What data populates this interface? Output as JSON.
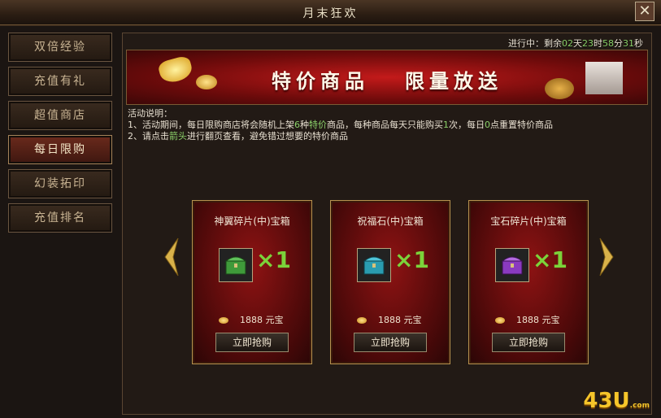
{
  "window": {
    "title": "月末狂欢",
    "close_label": "✕"
  },
  "sidebar": {
    "items": [
      {
        "label": "双倍经验"
      },
      {
        "label": "充值有礼"
      },
      {
        "label": "超值商店"
      },
      {
        "label": "每日限购"
      },
      {
        "label": "幻装拓印"
      },
      {
        "label": "充值排名"
      }
    ]
  },
  "status": {
    "prefix": "进行中：剩余",
    "days": "02",
    "days_unit": "天",
    "hours": "23",
    "hours_unit": "时",
    "minutes": "58",
    "minutes_unit": "分",
    "seconds": "31",
    "seconds_unit": "秒"
  },
  "banner": {
    "text1": "特价商品",
    "text2": "限量放送"
  },
  "description": {
    "title": "活动说明：",
    "line1_a": "1、活动期间，每日限购商店将会随机上架",
    "line1_b": "6",
    "line1_c": "种",
    "line1_d": "特价",
    "line1_e": "商品，每种商品每天只能购买",
    "line1_f": "1",
    "line1_g": "次，每日",
    "line1_h": "0",
    "line1_i": "点重置特价商品",
    "line2_a": "2、请点击",
    "line2_b": "箭头",
    "line2_c": "进行翻页查看，避免错过想要的特价商品"
  },
  "cards": [
    {
      "name": "神翼碎片(中)宝箱",
      "mult": "×1",
      "price": "1888",
      "currency": "元宝",
      "buy": "立即抢购",
      "chest_color": "#3f9a3a"
    },
    {
      "name": "祝福石(中)宝箱",
      "mult": "×1",
      "price": "1888",
      "currency": "元宝",
      "buy": "立即抢购",
      "chest_color": "#2a9cb0"
    },
    {
      "name": "宝石碎片(中)宝箱",
      "mult": "×1",
      "price": "1888",
      "currency": "元宝",
      "buy": "立即抢购",
      "chest_color": "#8a3ac0"
    }
  ],
  "logo": {
    "text": "43U",
    "suffix": ".com"
  }
}
